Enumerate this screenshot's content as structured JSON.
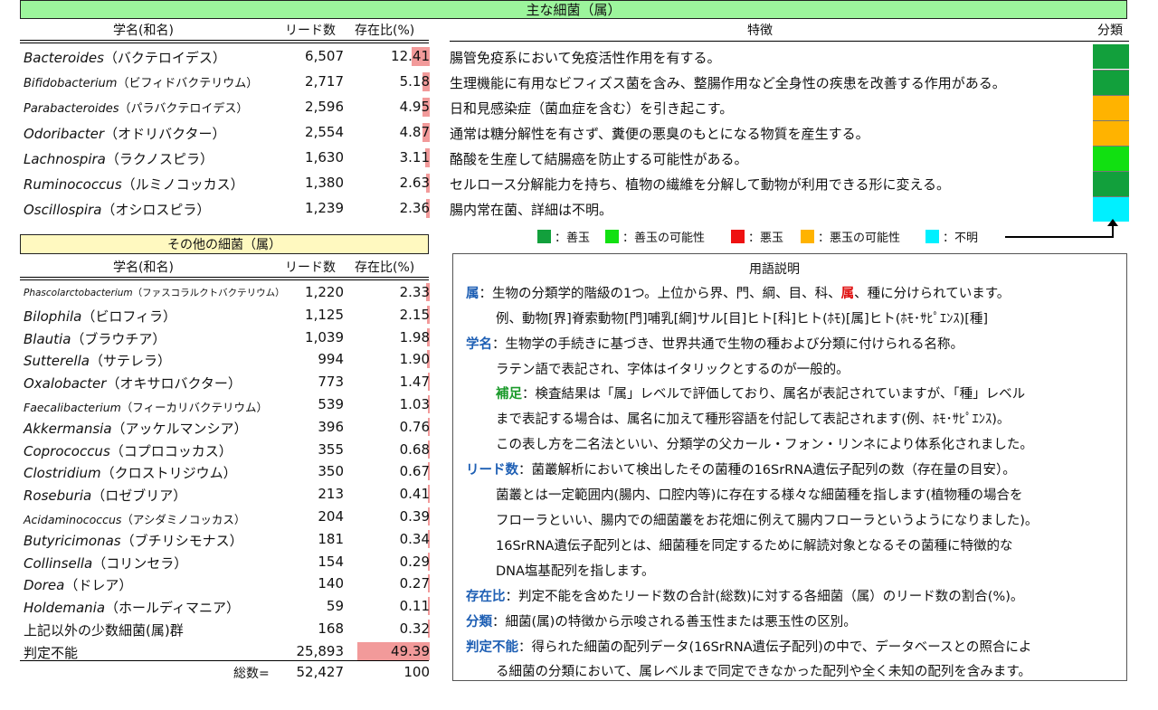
{
  "main": {
    "title": "主な細菌（属）",
    "col_name": "学名(和名)",
    "col_reads": "リード数",
    "col_ratio": "存在比(%)",
    "col_feature": "特徴",
    "col_class": "分類",
    "rows": [
      {
        "sci": "Bacteroides",
        "jp": "（バクテロイデス）",
        "reads": "6,507",
        "ratio": "12.41",
        "pct": 12.41,
        "feature": "腸管免疫系において免疫活性作用を有する。",
        "class_color": "#12a03c",
        "small": false
      },
      {
        "sci": "Bifidobacterium",
        "jp": "（ビフィドバクテリウム）",
        "reads": "2,717",
        "ratio": "5.18",
        "pct": 5.18,
        "feature": "生理機能に有用なビフィズス菌を含み、整腸作用など全身性の疾患を改善する作用がある。",
        "class_color": "#12a03c",
        "small": true
      },
      {
        "sci": "Parabacteroides",
        "jp": "（パラバクテロイデス）",
        "reads": "2,596",
        "ratio": "4.95",
        "pct": 4.95,
        "feature": "日和見感染症（菌血症を含む）を引き起こす。",
        "class_color": "#ffb300",
        "small": true
      },
      {
        "sci": "Odoribacter",
        "jp": "（オドリバクター）",
        "reads": "2,554",
        "ratio": "4.87",
        "pct": 4.87,
        "feature": "通常は糖分解性を有さず、糞便の悪臭のもとになる物質を産生する。",
        "class_color": "#ffb300",
        "small": false
      },
      {
        "sci": "Lachnospira",
        "jp": "（ラクノスピラ）",
        "reads": "1,630",
        "ratio": "3.11",
        "pct": 3.11,
        "feature": "酪酸を生産して結腸癌を防止する可能性がある。",
        "class_color": "#11e011",
        "small": false
      },
      {
        "sci": "Ruminococcus",
        "jp": "（ルミノコッカス）",
        "reads": "1,380",
        "ratio": "2.63",
        "pct": 2.63,
        "feature": "セルロース分解能力を持ち、植物の繊維を分解して動物が利用できる形に変える。",
        "class_color": "#12a03c",
        "small": false
      },
      {
        "sci": "Oscillospira",
        "jp": "（オシロスピラ）",
        "reads": "1,239",
        "ratio": "2.36",
        "pct": 2.36,
        "feature": "腸内常在菌、詳細は不明。",
        "class_color": "#00f0ff",
        "small": false
      }
    ]
  },
  "legend": [
    {
      "label": "：善玉",
      "color": "#12a03c"
    },
    {
      "label": "：善玉の可能性",
      "color": "#11e011"
    },
    {
      "label": "：悪玉",
      "color": "#ee1111"
    },
    {
      "label": "：悪玉の可能性",
      "color": "#ffb300"
    },
    {
      "label": "：不明",
      "color": "#00f0ff"
    }
  ],
  "other": {
    "title": "その他の細菌（属）",
    "col_name": "学名(和名)",
    "col_reads": "リード数",
    "col_ratio": "存在比(%)",
    "rows": [
      {
        "sci": "Phascolarctobacterium",
        "jp": "（ファスコラルクトバクテリウム）",
        "reads": "1,220",
        "ratio": "2.33",
        "pct": 2.33,
        "size": "xs"
      },
      {
        "sci": "Bilophila",
        "jp": "（ビロフィラ）",
        "reads": "1,125",
        "ratio": "2.15",
        "pct": 2.15,
        "size": "n"
      },
      {
        "sci": "Blautia",
        "jp": "（ブラウチア）",
        "reads": "1,039",
        "ratio": "1.98",
        "pct": 1.98,
        "size": "n"
      },
      {
        "sci": "Sutterella",
        "jp": "（サテレラ）",
        "reads": "994",
        "ratio": "1.90",
        "pct": 1.9,
        "size": "n"
      },
      {
        "sci": "Oxalobacter",
        "jp": "（オキサロバクター）",
        "reads": "773",
        "ratio": "1.47",
        "pct": 1.47,
        "size": "n"
      },
      {
        "sci": "Faecalibacterium",
        "jp": "（フィーカリバクテリウム）",
        "reads": "539",
        "ratio": "1.03",
        "pct": 1.03,
        "size": "s"
      },
      {
        "sci": "Akkermansia",
        "jp": "（アッケルマンシア）",
        "reads": "396",
        "ratio": "0.76",
        "pct": 0.76,
        "size": "n"
      },
      {
        "sci": "Coprococcus",
        "jp": "（コプロコッカス）",
        "reads": "355",
        "ratio": "0.68",
        "pct": 0.68,
        "size": "n"
      },
      {
        "sci": "Clostridium",
        "jp": "（クロストリジウム）",
        "reads": "350",
        "ratio": "0.67",
        "pct": 0.67,
        "size": "n"
      },
      {
        "sci": "Roseburia",
        "jp": "（ロゼブリア）",
        "reads": "213",
        "ratio": "0.41",
        "pct": 0.41,
        "size": "n"
      },
      {
        "sci": "Acidaminococcus",
        "jp": "（アシダミノコッカス）",
        "reads": "204",
        "ratio": "0.39",
        "pct": 0.39,
        "size": "s"
      },
      {
        "sci": "Butyricimonas",
        "jp": "（ブチリシモナス）",
        "reads": "181",
        "ratio": "0.34",
        "pct": 0.34,
        "size": "n"
      },
      {
        "sci": "Collinsella",
        "jp": "（コリンセラ）",
        "reads": "154",
        "ratio": "0.29",
        "pct": 0.29,
        "size": "n"
      },
      {
        "sci": "Dorea",
        "jp": "（ドレア）",
        "reads": "140",
        "ratio": "0.27",
        "pct": 0.27,
        "size": "n"
      },
      {
        "sci": "Holdemania",
        "jp": "（ホールディマニア）",
        "reads": "59",
        "ratio": "0.11",
        "pct": 0.11,
        "size": "n"
      },
      {
        "sci": "",
        "jp": "上記以外の少数細菌(属)群",
        "reads": "168",
        "ratio": "0.32",
        "pct": 0.32,
        "size": "n"
      },
      {
        "sci": "",
        "jp": "判定不能",
        "reads": "25,893",
        "ratio": "49.39",
        "pct": 49.39,
        "size": "n"
      }
    ],
    "total_label": "総数=",
    "total_reads": "52,427",
    "total_ratio": "100"
  },
  "glossary": {
    "title": "用語説明",
    "zoku_term": "属",
    "zoku_text_a": "：生物の分類学的階級の1つ。上位から界、門、綱、目、科、",
    "zoku_red": "属",
    "zoku_text_b": "、種に分けられています。",
    "zoku_example": "例、動物[界]脊索動物[門]哺乳[綱]サル[目]ヒト[科]ヒト(ﾎﾓ)[属]ヒト(ﾎﾓ･ｻﾋﾟｴﾝｽ)[種]",
    "gakumei_term": "学名",
    "gakumei_text": "：生物学の手続きに基づき、世界共通で生物の種および分類に付けられる名称。",
    "gakumei_line2": "ラテン語で表記され、字体はイタリックとするのが一般的。",
    "hosoku_term": "補足",
    "hosoku_text": "：検査結果は「属」レベルで評価しており、属名が表記されていますが、「種」レベル",
    "hosoku_line2": "まで表記する場合は、属名に加えて種形容語を付記して表記されます(例、ﾎﾓ･ｻﾋﾟｴﾝｽ)。",
    "hosoku_line3": "この表し方を二名法といい、分類学の父カール・フォン・リンネにより体系化されました。",
    "read_term": "リード数",
    "read_text": "：菌叢解析において検出したその菌種の16SrRNA遺伝子配列の数（存在量の目安）。",
    "read_line2": "菌叢とは一定範囲内(腸内、口腔内等)に存在する様々な細菌種を指します(植物種の場合を",
    "read_line3": "フローラといい、腸内での細菌叢をお花畑に例えて腸内フローラというようになりました)。",
    "read_line4": "16SrRNA遺伝子配列とは、細菌種を同定するために解読対象となるその菌種に特徴的な",
    "read_line5": "DNA塩基配列を指します。",
    "ratio_term": "存在比",
    "ratio_text": "：判定不能を含めたリード数の合計(総数)に対する各細菌（属）のリード数の割合(%)。",
    "class_term": "分類",
    "class_text": "：細菌(属)の特徴から示唆される善玉性または悪玉性の区別。",
    "undet_term": "判定不能",
    "undet_text": "：得られた細菌の配列データ(16SrRNA遺伝子配列)の中で、データベースとの照合によ",
    "undet_line2": "る細菌の分類において、属レベルまで同定できなかった配列や全く未知の配列を含みます。"
  }
}
